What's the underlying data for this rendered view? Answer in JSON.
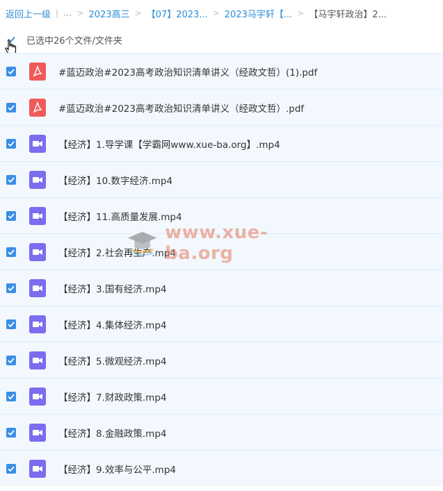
{
  "breadcrumb": {
    "back": "返回上一级",
    "ellipsis": "...",
    "items": [
      "2023高三",
      "【07】2023...",
      "2023马宇轩【..."
    ],
    "current": "【马宇轩政治】2..."
  },
  "selection": {
    "text": "已选中26个文件/文件夹"
  },
  "files": [
    {
      "name": "#蓝迈政治#2023高考政治知识清单讲义（经政文哲）(1).pdf",
      "type": "pdf"
    },
    {
      "name": "#蓝迈政治#2023高考政治知识清单讲义（经政文哲）.pdf",
      "type": "pdf"
    },
    {
      "name": "【经济】1.导学课【学霸网www.xue-ba.org】.mp4",
      "type": "video"
    },
    {
      "name": "【经济】10.数字经济.mp4",
      "type": "video"
    },
    {
      "name": "【经济】11.高质量发展.mp4",
      "type": "video"
    },
    {
      "name": "【经济】2.社会再生产.mp4",
      "type": "video"
    },
    {
      "name": "【经济】3.国有经济.mp4",
      "type": "video"
    },
    {
      "name": "【经济】4.集体经济.mp4",
      "type": "video"
    },
    {
      "name": "【经济】5.微观经济.mp4",
      "type": "video"
    },
    {
      "name": "【经济】7.财政政策.mp4",
      "type": "video"
    },
    {
      "name": "【经济】8.金融政策.mp4",
      "type": "video"
    },
    {
      "name": "【经济】9.效率与公平.mp4",
      "type": "video"
    }
  ],
  "watermark": {
    "text": "www.xue-ba.org"
  },
  "colors": {
    "link": "#2b8ed8",
    "checkbox": "#3a8ee6",
    "pdf_icon": "#f05a5a",
    "video_icon": "#7b6cf0",
    "row_bg": "#f2f8fe"
  }
}
